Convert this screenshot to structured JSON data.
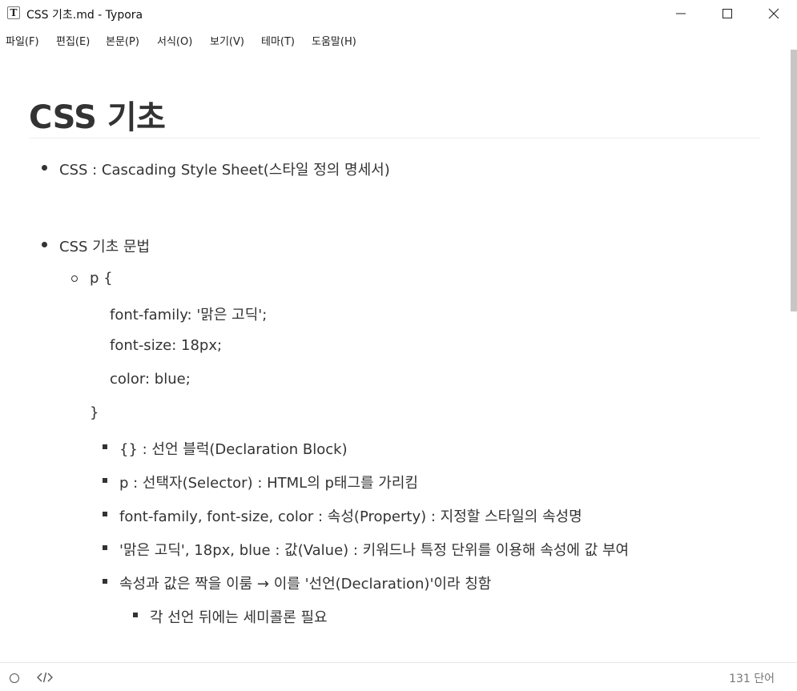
{
  "window": {
    "title": "CSS 기초.md - Typora",
    "app_icon_letter": "T"
  },
  "menu": [
    "파일(F)",
    "편집(E)",
    "본문(P)",
    "서식(O)",
    "보기(V)",
    "테마(T)",
    "도움말(H)"
  ],
  "document": {
    "heading": "CSS 기초",
    "item1": "CSS : Cascading Style Sheet(스타일 정의 명세서)",
    "item2": "CSS 기초 문법",
    "code_open": "p {",
    "code_lines": [
      "font-family: '맑은 고딕';",
      "font-size: 18px;",
      "color: blue;"
    ],
    "code_close": "}",
    "sub_items": [
      "{} : 선언 블럭(Declaration Block)",
      "p : 선택자(Selector) : HTML의 p태그를 가리킴",
      "font-family, font-size, color : 속성(Property) : 지정할 스타일의 속성명",
      "'맑은 고딕', 18px, blue : 값(Value) : 키워드나 특정 단위를 이용해 속성에 값 부여",
      "속성과 값은 짝을 이룸 → 이를 '선언(Declaration)'이라 칭함"
    ],
    "sub_sub_item": "각 선언 뒤에는 세미콜론 필요"
  },
  "status": {
    "word_count": "131 단어"
  },
  "colors": {
    "text": "#333333",
    "scrollbar_thumb": "#c6c6c6",
    "rule": "#eeeeee"
  }
}
